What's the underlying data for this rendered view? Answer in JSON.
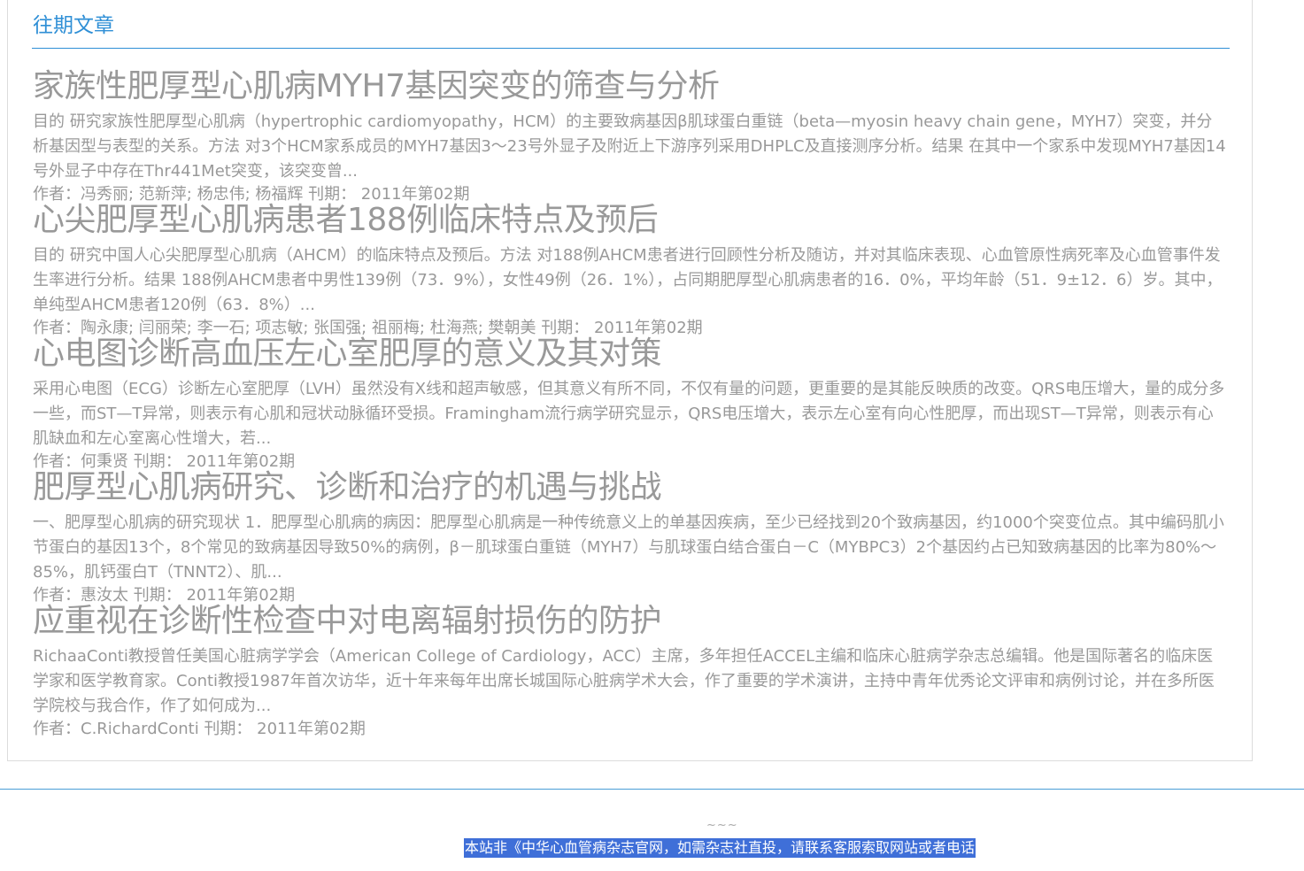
{
  "section": {
    "title": "往期文章"
  },
  "articles": [
    {
      "title": "家族性肥厚型心肌病MYH7基因突变的筛查与分析",
      "summary": "目的 研究家族性肥厚型心肌病（hypertrophic cardiomyopathy，HCM）的主要致病基因β肌球蛋白重链（beta—myosin heavy chain gene，MYH7）突变，并分析基因型与表型的关系。方法 对3个HCM家系成员的MYH7基因3～23号外显子及附近上下游序列采用DHPLC及直接测序分析。结果 在其中一个家系中发现MYH7基因14号外显子中存在Thr441Met突变，该突变曾...",
      "meta": "作者：冯秀丽; 范新萍; 杨忠伟; 杨福辉 刊期： 2011年第02期"
    },
    {
      "title": "心尖肥厚型心肌病患者188例临床特点及预后",
      "summary": "目的 研究中国人心尖肥厚型心肌病（AHCM）的临床特点及预后。方法 对188例AHCM患者进行回顾性分析及随访，并对其临床表现、心血管原性病死率及心血管事件发生率进行分析。结果 188例AHCM患者中男性139例（73．9%），女性49例（26．1%），占同期肥厚型心肌病患者的16．0%，平均年龄（51．9±12．6）岁。其中，单纯型AHCM患者120例（63．8%）...",
      "meta": "作者：陶永康; 闫丽荣; 李一石; 项志敏; 张国强; 祖丽梅; 杜海燕; 樊朝美 刊期： 2011年第02期"
    },
    {
      "title": "心电图诊断高血压左心室肥厚的意义及其对策",
      "summary": "采用心电图（ECG）诊断左心室肥厚（LVH）虽然没有X线和超声敏感，但其意义有所不同，不仅有量的问题，更重要的是其能反映质的改变。QRS电压增大，量的成分多一些，而ST—T异常，则表示有心肌和冠状动脉循环受损。Framingham流行病学研究显示，QRS电压增大，表示左心室有向心性肥厚，而出现ST—T异常，则表示有心肌缺血和左心室离心性增大，若...",
      "meta": "作者：何秉贤 刊期： 2011年第02期"
    },
    {
      "title": "肥厚型心肌病研究、诊断和治疗的机遇与挑战",
      "summary": "一、肥厚型心肌病的研究现状 1．肥厚型心肌病的病因：肥厚型心肌病是一种传统意义上的单基因疾病，至少已经找到20个致病基因，约1000个突变位点。其中编码肌小节蛋白的基因13个，8个常见的致病基因导致50%的病例，β－肌球蛋白重链（MYH7）与肌球蛋白结合蛋白－C（MYBPC3）2个基因约占已知致病基因的比率为80%～85%，肌钙蛋白T（TNNT2）、肌...",
      "meta": "作者：惠汝太 刊期： 2011年第02期"
    },
    {
      "title": "应重视在诊断性检查中对电离辐射损伤的防护",
      "summary": "RichaaConti教授曾任美国心脏病学学会（American College of Cardiology，ACC）主席，多年担任ACCEL主编和临床心脏病学杂志总编辑。他是国际著名的临床医学家和医学教育家。Conti教授1987年首次访华，近十年来每年出席长城国际心脏病学术大会，作了重要的学术演讲，主持中青年优秀论文评审和病例讨论，并在多所医学院校与我合作，作了如何成为...",
      "meta": "作者：C.RichardConti 刊期： 2011年第02期"
    }
  ],
  "footer": {
    "mark": "~~~",
    "note": "本站非《中华心血管病杂志官网，如需杂志社直投，请联系客服索取网站或者电话"
  },
  "colors": {
    "accent": "#2f8fd6",
    "text_muted": "#999999",
    "highlight": "#3f6fd8"
  }
}
